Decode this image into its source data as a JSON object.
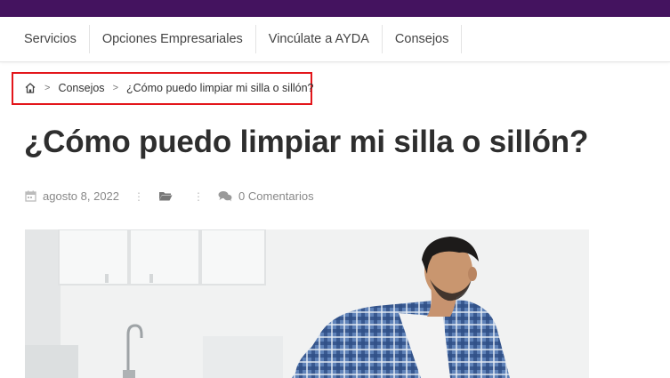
{
  "nav": {
    "items": [
      {
        "label": "Servicios"
      },
      {
        "label": "Opciones Empresariales"
      },
      {
        "label": "Vincúlate a AYDA"
      },
      {
        "label": "Consejos"
      }
    ]
  },
  "breadcrumb": {
    "home_icon": "home-icon",
    "separator": ">",
    "items": [
      {
        "label": "Consejos"
      },
      {
        "label": "¿Cómo puedo limpiar mi silla o sillón?"
      }
    ]
  },
  "article": {
    "title": "¿Cómo puedo limpiar mi silla o sillón?",
    "date": "agosto 8, 2022",
    "comments": "0 Comentarios",
    "meta_separator": "⋮"
  },
  "colors": {
    "topbar": "#44135f",
    "highlight_border": "#e3161b"
  }
}
